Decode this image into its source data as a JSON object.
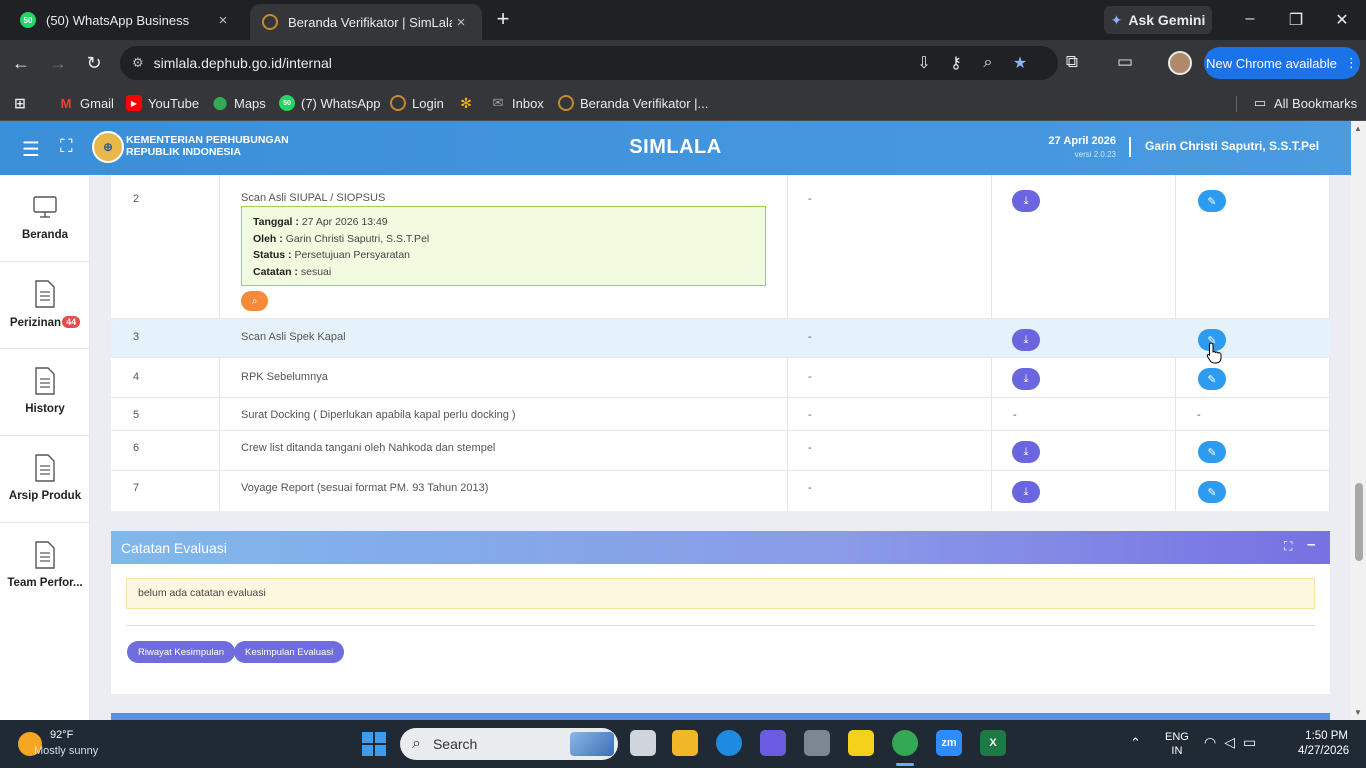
{
  "browser": {
    "tabs": [
      {
        "title": "(50) WhatsApp Business",
        "favicon_text": "50",
        "active": false
      },
      {
        "title": "Beranda Verifikator | SimLala",
        "active": true
      }
    ],
    "new_tab": "+",
    "close_glyph": "×",
    "ask_gemini": "Ask Gemini",
    "window_controls": {
      "minimize": "–",
      "maximize": "❐",
      "close": "✕"
    },
    "url": "simlala.dephub.go.id/internal",
    "new_chrome": "New Chrome available",
    "bookmarks": [
      {
        "label": "Gmail",
        "icon": "gmail-icon"
      },
      {
        "label": "YouTube",
        "icon": "youtube-icon"
      },
      {
        "label": "Maps",
        "icon": "maps-icon"
      },
      {
        "label": "(7) WhatsApp",
        "icon": "whatsapp-icon",
        "icon_text": "50"
      },
      {
        "label": "Login",
        "icon": "simlala-icon"
      },
      {
        "label": "",
        "icon": "pinwheel-icon"
      },
      {
        "label": "Inbox",
        "icon": "mail-icon"
      },
      {
        "label": "Beranda Verifikator |...",
        "icon": "simlala-icon"
      }
    ],
    "all_bookmarks": "All Bookmarks"
  },
  "header": {
    "org_line1": "KEMENTERIAN PERHUBUNGAN",
    "org_line2": "REPUBLIK INDONESIA",
    "app_title": "SIMLALA",
    "date": "27 April 2026",
    "version": "versi 2.0.23",
    "user": "Garin Christi Saputri, S.S.T.Pel"
  },
  "sidebar": {
    "items": [
      {
        "label": "Beranda",
        "icon": "monitor-icon"
      },
      {
        "label": "Perizinan",
        "icon": "document-icon",
        "badge": "44"
      },
      {
        "label": "History",
        "icon": "document-icon"
      },
      {
        "label": "Arsip Produk",
        "icon": "document-icon"
      },
      {
        "label": "Team Perfor...",
        "icon": "document-icon"
      }
    ]
  },
  "documents": {
    "rows": [
      {
        "no": "2",
        "name": "Scan Asli SIUPAL / SIOPSUS",
        "col3": "-",
        "has_download": true,
        "has_edit": true,
        "note": {
          "tanggal_label": "Tanggal :",
          "tanggal": "27 Apr 2026 13:49",
          "oleh_label": "Oleh :",
          "oleh": "Garin Christi Saputri, S.S.T.Pel",
          "status_label": "Status :",
          "status": "Persetujuan Persyaratan",
          "catatan_label": "Catatan :",
          "catatan": "sesuai"
        }
      },
      {
        "no": "3",
        "name": "Scan Asli Spek Kapal",
        "col3": "-",
        "has_download": true,
        "has_edit": true
      },
      {
        "no": "4",
        "name": "RPK Sebelumnya",
        "col3": "-",
        "has_download": true,
        "has_edit": true
      },
      {
        "no": "5",
        "name": "Surat Docking ( Diperlukan apabila kapal perlu docking )",
        "col3": "-",
        "col4": "-",
        "col5": "-"
      },
      {
        "no": "6",
        "name": "Crew list ditanda tangani oleh Nahkoda dan stempel",
        "col3": "-",
        "has_download": true,
        "has_edit": true
      },
      {
        "no": "7",
        "name": "Voyage Report (sesuai format PM. 93 Tahun 2013)",
        "col3": "-",
        "has_download": true,
        "has_edit": true
      }
    ]
  },
  "evaluasi": {
    "title": "Catatan Evaluasi",
    "note": "belum ada catatan evaluasi",
    "buttons": {
      "riwayat": "Riwayat Kesimpulan",
      "kesimpulan": "Kesimpulan Evaluasi"
    }
  },
  "taskbar": {
    "weather_temp": "92°F",
    "weather_desc": "Mostly sunny",
    "search_placeholder": "Search",
    "lang_line1": "ENG",
    "lang_line2": "IN",
    "time": "1:50 PM",
    "date": "4/27/2026"
  },
  "colors": {
    "header_blue": "#3a8fd9",
    "download_button": "#6b66e0",
    "edit_button": "#2c9bf0",
    "note_green_bg": "#f2fadf",
    "search_button": "#f58a3a",
    "eval_button": "#6f6ce0",
    "chrome_update": "#1a73e8"
  }
}
